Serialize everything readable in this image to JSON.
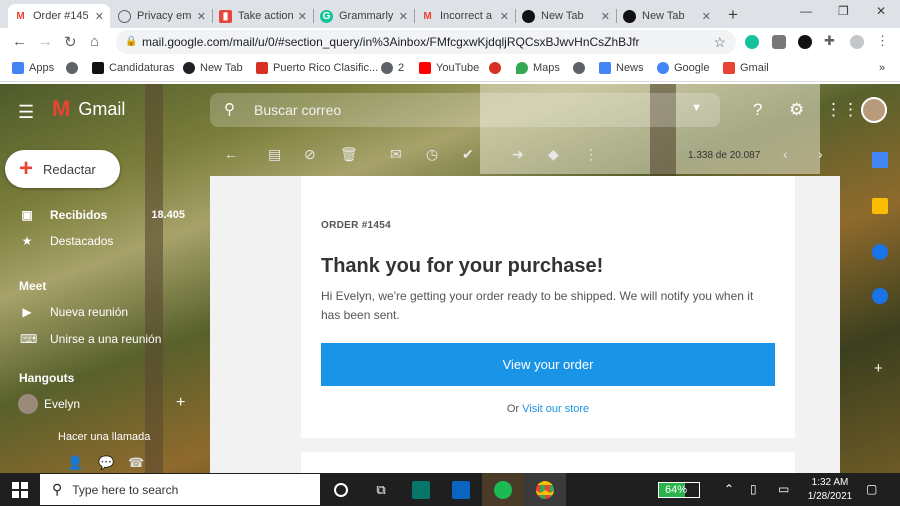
{
  "browser": {
    "tabs": [
      {
        "title": "Order #145",
        "icon": "gmail-icon",
        "active": true
      },
      {
        "title": "Privacy em",
        "icon": "globe-icon",
        "active": false
      },
      {
        "title": "Take action",
        "icon": "page-icon",
        "active": false
      },
      {
        "title": "Grammarly",
        "icon": "grammarly-icon",
        "active": false
      },
      {
        "title": "Incorrect a",
        "icon": "gmail-icon",
        "active": false
      },
      {
        "title": "New Tab",
        "icon": "newtab-icon",
        "active": false
      },
      {
        "title": "New Tab",
        "icon": "newtab-icon",
        "active": false
      }
    ],
    "new_tab_label": "+",
    "url": "mail.google.com/mail/u/0/#section_query/in%3Ainbox/FMfcgxwKjdqljRQCsxBJwvHnCsZhBJfr",
    "bookmarks": [
      {
        "label": "Apps",
        "color": "#4285f4"
      },
      {
        "label": "",
        "color": "#5f6368"
      },
      {
        "label": "Candidaturas",
        "color": "#111111"
      },
      {
        "label": "New Tab",
        "color": "#202124"
      },
      {
        "label": "Puerto Rico Clasific...",
        "color": "#d93025"
      },
      {
        "label": "2",
        "color": "#5f6368"
      },
      {
        "label": "YouTube",
        "color": "#ff0000"
      },
      {
        "label": "",
        "color": "#d93025"
      },
      {
        "label": "Maps",
        "color": "#34a853"
      },
      {
        "label": "",
        "color": "#5f6368"
      },
      {
        "label": "News",
        "color": "#4285f4"
      },
      {
        "label": "Google",
        "color": "#4285f4"
      },
      {
        "label": "Gmail",
        "color": "#ea4335"
      }
    ],
    "bookmarks_more": "»"
  },
  "gmail": {
    "app_name": "Gmail",
    "search_placeholder": "Buscar correo",
    "compose_label": "Redactar",
    "nav": [
      {
        "label": "Recibidos",
        "count": "18.405",
        "icon": "inbox-icon"
      },
      {
        "label": "Destacados",
        "count": "",
        "icon": "star-icon"
      }
    ],
    "meet": {
      "title": "Meet",
      "items": [
        {
          "label": "Nueva reunión",
          "icon": "video-icon"
        },
        {
          "label": "Unirse a una reunión",
          "icon": "keyboard-icon"
        }
      ]
    },
    "hangouts": {
      "title": "Hangouts",
      "user": "Evelyn",
      "call_label": "Hacer una llamada"
    },
    "pager": "1.338 de 20.087",
    "message": {
      "order_number": "ORDER #1454",
      "heading": "Thank you for your purchase!",
      "body": "Hi Evelyn, we're getting your order ready to be shipped. We will notify you when it has been sent.",
      "button_label": "View your order",
      "store_prefix": "Or",
      "store_link": "Visit our store"
    }
  },
  "taskbar": {
    "search_placeholder": "Type here to search",
    "battery_percent": 64,
    "battery_label": "64%",
    "time": "1:32 AM",
    "date": "1/28/2021"
  },
  "colors": {
    "accent_blue": "#1a94e6",
    "gmail_red": "#ea4335",
    "taskbar_bg": "#1f1f1f"
  }
}
